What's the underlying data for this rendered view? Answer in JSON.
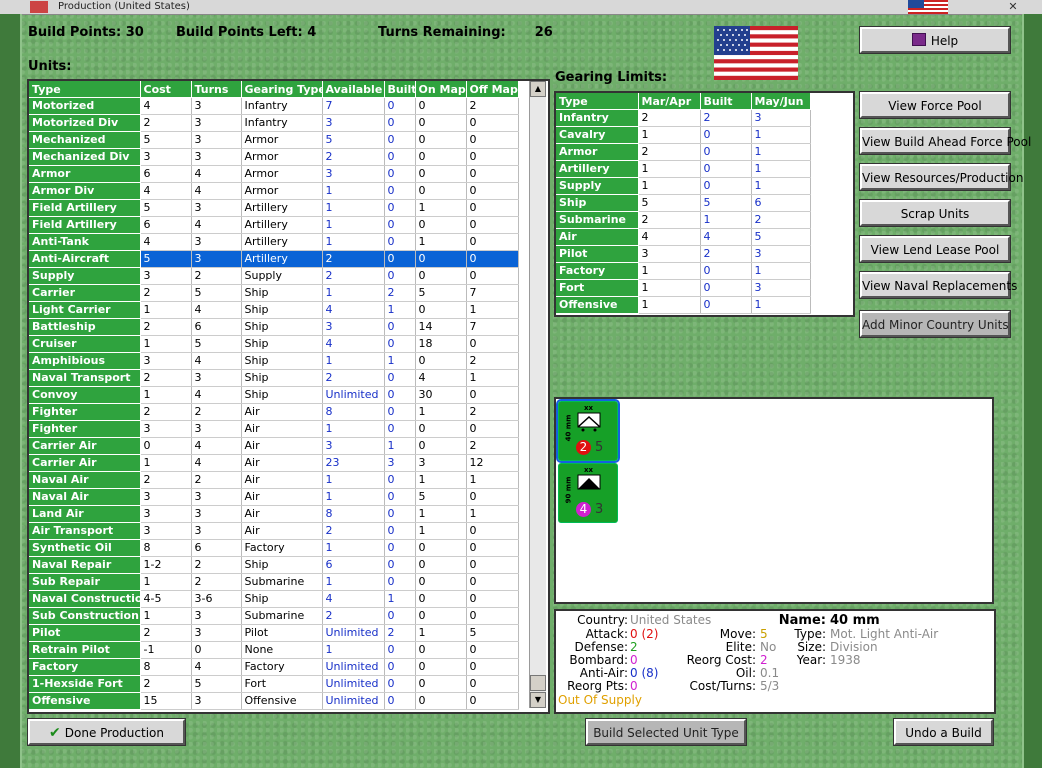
{
  "window": {
    "title": "Production (United States)"
  },
  "header": {
    "build_points_label": "Build Points:",
    "build_points": "30",
    "build_points_left_label": "Build Points Left:",
    "build_points_left": "4",
    "turns_remaining_label": "Turns Remaining:",
    "turns_remaining": "26"
  },
  "units": {
    "title": "Units:",
    "columns": [
      "Type",
      "Cost",
      "Turns",
      "Gearing Type",
      "Available",
      "Built",
      "On Map",
      "Off Map"
    ],
    "rows": [
      [
        "Motorized",
        "4",
        "3",
        "Infantry",
        "7",
        "0",
        "0",
        "2"
      ],
      [
        "Motorized Div",
        "2",
        "3",
        "Infantry",
        "3",
        "0",
        "0",
        "0"
      ],
      [
        "Mechanized",
        "5",
        "3",
        "Armor",
        "5",
        "0",
        "0",
        "0"
      ],
      [
        "Mechanized Div",
        "3",
        "3",
        "Armor",
        "2",
        "0",
        "0",
        "0"
      ],
      [
        "Armor",
        "6",
        "4",
        "Armor",
        "3",
        "0",
        "0",
        "0"
      ],
      [
        "Armor Div",
        "4",
        "4",
        "Armor",
        "1",
        "0",
        "0",
        "0"
      ],
      [
        "Field Artillery",
        "5",
        "3",
        "Artillery",
        "1",
        "0",
        "1",
        "0"
      ],
      [
        "Field Artillery",
        "6",
        "4",
        "Artillery",
        "1",
        "0",
        "0",
        "0"
      ],
      [
        "Anti-Tank",
        "4",
        "3",
        "Artillery",
        "1",
        "0",
        "1",
        "0"
      ],
      [
        "Anti-Aircraft",
        "5",
        "3",
        "Artillery",
        "2",
        "0",
        "0",
        "0"
      ],
      [
        "Supply",
        "3",
        "2",
        "Supply",
        "2",
        "0",
        "0",
        "0"
      ],
      [
        "Carrier",
        "2",
        "5",
        "Ship",
        "1",
        "2",
        "5",
        "7"
      ],
      [
        "Light Carrier",
        "1",
        "4",
        "Ship",
        "4",
        "1",
        "0",
        "1"
      ],
      [
        "Battleship",
        "2",
        "6",
        "Ship",
        "3",
        "0",
        "14",
        "7"
      ],
      [
        "Cruiser",
        "1",
        "5",
        "Ship",
        "4",
        "0",
        "18",
        "0"
      ],
      [
        "Amphibious",
        "3",
        "4",
        "Ship",
        "1",
        "1",
        "0",
        "2"
      ],
      [
        "Naval Transport",
        "2",
        "3",
        "Ship",
        "2",
        "0",
        "4",
        "1"
      ],
      [
        "Convoy",
        "1",
        "4",
        "Ship",
        "Unlimited",
        "0",
        "30",
        "0"
      ],
      [
        "Fighter",
        "2",
        "2",
        "Air",
        "8",
        "0",
        "1",
        "2"
      ],
      [
        "Fighter",
        "3",
        "3",
        "Air",
        "1",
        "0",
        "0",
        "0"
      ],
      [
        "Carrier Air",
        "0",
        "4",
        "Air",
        "3",
        "1",
        "0",
        "2"
      ],
      [
        "Carrier Air",
        "1",
        "4",
        "Air",
        "23",
        "3",
        "3",
        "12"
      ],
      [
        "Naval Air",
        "2",
        "2",
        "Air",
        "1",
        "0",
        "1",
        "1"
      ],
      [
        "Naval Air",
        "3",
        "3",
        "Air",
        "1",
        "0",
        "5",
        "0"
      ],
      [
        "Land Air",
        "3",
        "3",
        "Air",
        "8",
        "0",
        "1",
        "1"
      ],
      [
        "Air Transport",
        "3",
        "3",
        "Air",
        "2",
        "0",
        "1",
        "0"
      ],
      [
        "Synthetic Oil",
        "8",
        "6",
        "Factory",
        "1",
        "0",
        "0",
        "0"
      ],
      [
        "Naval Repair",
        "1-2",
        "2",
        "Ship",
        "6",
        "0",
        "0",
        "0"
      ],
      [
        "Sub Repair",
        "1",
        "2",
        "Submarine",
        "1",
        "0",
        "0",
        "0"
      ],
      [
        "Naval Construction",
        "4-5",
        "3-6",
        "Ship",
        "4",
        "1",
        "0",
        "0"
      ],
      [
        "Sub Construction",
        "1",
        "3",
        "Submarine",
        "2",
        "0",
        "0",
        "0"
      ],
      [
        "Pilot",
        "2",
        "3",
        "Pilot",
        "Unlimited",
        "2",
        "1",
        "5"
      ],
      [
        "Retrain Pilot",
        "-1",
        "0",
        "None",
        "1",
        "0",
        "0",
        "0"
      ],
      [
        "Factory",
        "8",
        "4",
        "Factory",
        "Unlimited",
        "0",
        "0",
        "0"
      ],
      [
        "1-Hexside Fort",
        "2",
        "5",
        "Fort",
        "Unlimited",
        "0",
        "0",
        "0"
      ],
      [
        "Offensive",
        "15",
        "3",
        "Offensive",
        "Unlimited",
        "0",
        "0",
        "0"
      ]
    ],
    "selected_index": 9
  },
  "gearing": {
    "title": "Gearing Limits:",
    "columns": [
      "Type",
      "Mar/Apr",
      "Built",
      "May/Jun"
    ],
    "rows": [
      [
        "Infantry",
        "2",
        "2",
        "3"
      ],
      [
        "Cavalry",
        "1",
        "0",
        "1"
      ],
      [
        "Armor",
        "2",
        "0",
        "1"
      ],
      [
        "Artillery",
        "1",
        "0",
        "1"
      ],
      [
        "Supply",
        "1",
        "0",
        "1"
      ],
      [
        "Ship",
        "5",
        "5",
        "6"
      ],
      [
        "Submarine",
        "2",
        "1",
        "2"
      ],
      [
        "Air",
        "4",
        "4",
        "5"
      ],
      [
        "Pilot",
        "3",
        "2",
        "3"
      ],
      [
        "Factory",
        "1",
        "0",
        "1"
      ],
      [
        "Fort",
        "1",
        "0",
        "3"
      ],
      [
        "Offensive",
        "1",
        "0",
        "1"
      ]
    ]
  },
  "buttons": {
    "help": "Help",
    "view_force_pool": "View Force Pool",
    "view_build_ahead": "View Build Ahead Force Pool",
    "view_resources": "View Resources/Production",
    "scrap_units": "Scrap Units",
    "view_lend_lease": "View Lend Lease Pool",
    "view_naval_replacements": "View Naval Replacements",
    "add_minor_country": "Add Minor Country Units",
    "done_production": "Done Production",
    "build_selected": "Build Selected Unit Type",
    "undo_build": "Undo a Build"
  },
  "counters": [
    {
      "side_label": "40 mm",
      "strength": "2",
      "move": "5",
      "badge_color": "#e01010"
    },
    {
      "side_label": "90 mm",
      "strength": "4",
      "move": "3",
      "badge_color": "#d020d0"
    }
  ],
  "counter_size_mark": "xx",
  "unit_info": {
    "country_label": "Country:",
    "country": "United States",
    "attack_label": "Attack:",
    "attack": "0",
    "attack_extra": "(2)",
    "defense_label": "Defense:",
    "defense": "2",
    "bombard_label": "Bombard:",
    "bombard": "0",
    "antiair_label": "Anti-Air:",
    "antiair": "0",
    "antiair_extra": "(8)",
    "reorg_pts_label": "Reorg Pts:",
    "reorg_pts": "0",
    "supply_status": "Out Of Supply",
    "move_label": "Move:",
    "move": "5",
    "elite_label": "Elite:",
    "elite": "No",
    "reorg_cost_label": "Reorg Cost:",
    "reorg_cost": "2",
    "oil_label": "Oil:",
    "oil": "0.1",
    "cost_turns_label": "Cost/Turns:",
    "cost_turns": "5/3",
    "name_label": "Name:",
    "name": "40 mm",
    "type_label": "Type:",
    "type": "Mot. Light Anti-Air",
    "size_label": "Size:",
    "size": "Division",
    "year_label": "Year:",
    "year": "1938"
  },
  "colors": {
    "header_green": "#2fa33e",
    "selection_blue": "#0a63d6",
    "link_blue": "#1830c8",
    "grey_text": "#8a8a8a",
    "supply_orange": "#e0a000"
  }
}
